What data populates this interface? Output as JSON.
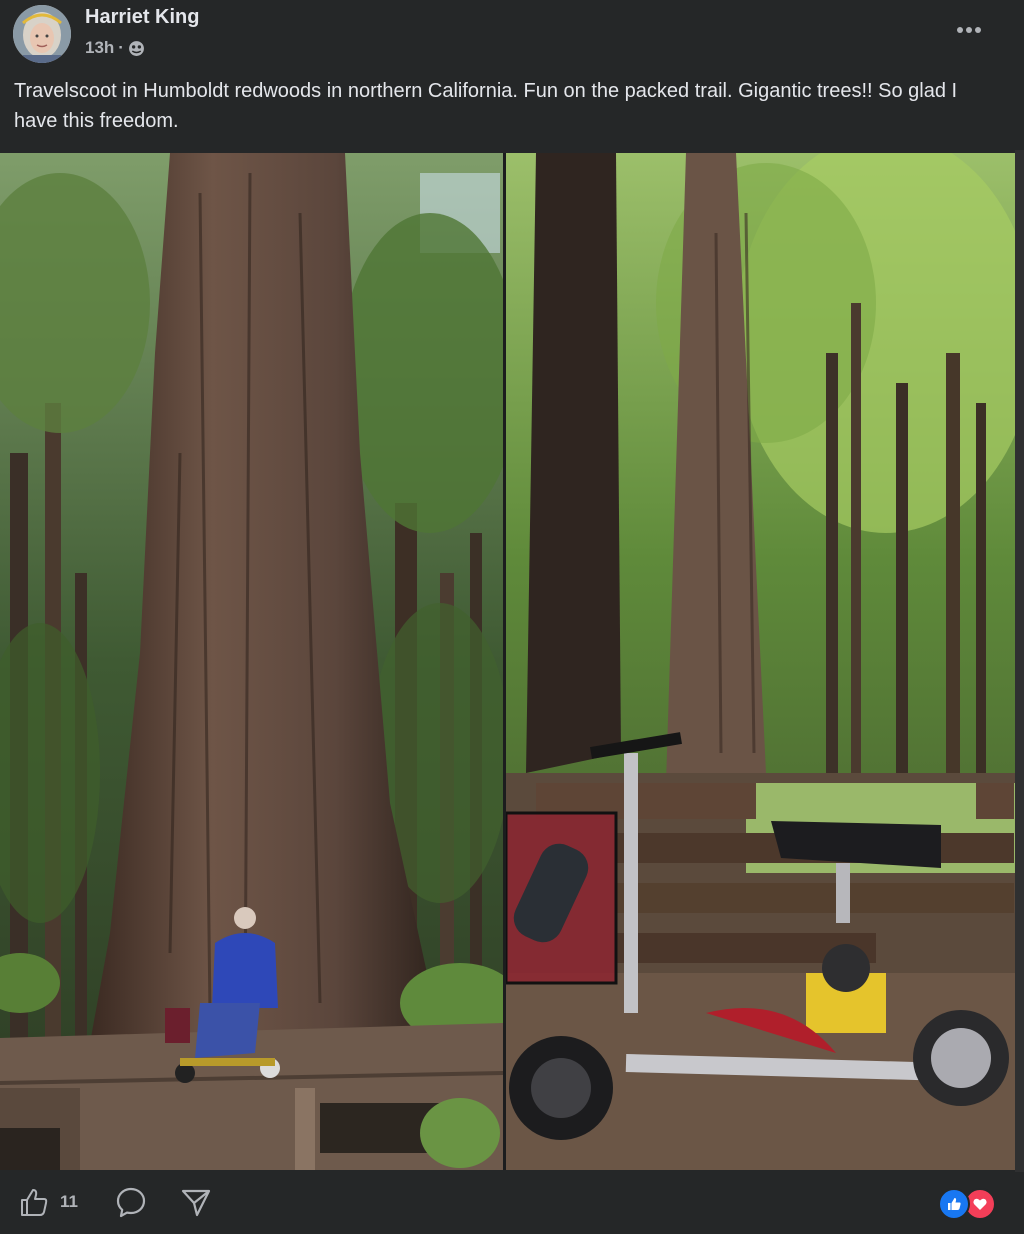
{
  "post": {
    "author": "Harriet King",
    "time": "13h",
    "separator": "·",
    "audience_icon": "globe-icon",
    "more_icon": "more-dots-icon",
    "caption": "Travelscoot in Humboldt redwoods in northern California. Fun on the packed trail. Gigantic trees!! So glad I have this freedom."
  },
  "photos": [
    {
      "name": "woman-on-scooter-at-giant-redwood"
    },
    {
      "name": "folded-scooter-by-wooden-fence"
    }
  ],
  "actions": {
    "like_icon": "thumbs-up-icon",
    "like_count": "11",
    "comment_icon": "comment-bubble-icon",
    "share_icon": "share-arrow-icon",
    "reactions": [
      "like",
      "love"
    ]
  },
  "colors": {
    "background": "#252728",
    "text": "#e4e6eb",
    "secondary_text": "#b0b3b8",
    "like_blue": "#1877f2",
    "love_red": "#f33e58"
  }
}
